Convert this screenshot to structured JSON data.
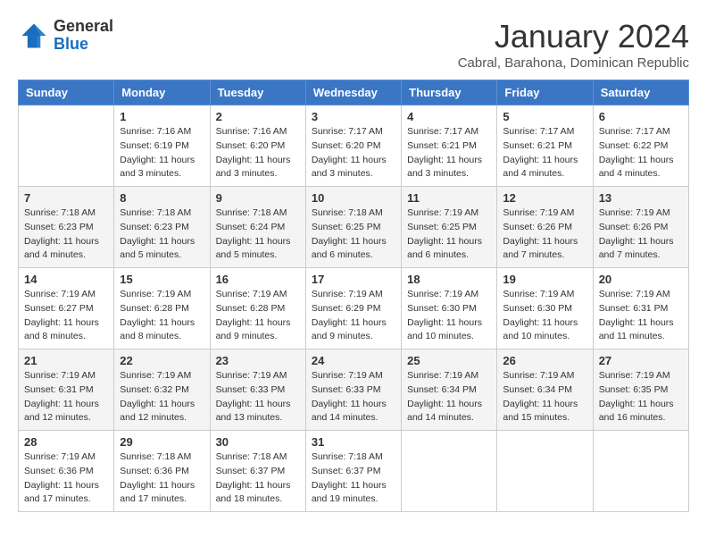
{
  "header": {
    "logo_general": "General",
    "logo_blue": "Blue",
    "main_title": "January 2024",
    "subtitle": "Cabral, Barahona, Dominican Republic"
  },
  "days_of_week": [
    "Sunday",
    "Monday",
    "Tuesday",
    "Wednesday",
    "Thursday",
    "Friday",
    "Saturday"
  ],
  "weeks": [
    [
      {
        "day": "",
        "info": ""
      },
      {
        "day": "1",
        "info": "Sunrise: 7:16 AM\nSunset: 6:19 PM\nDaylight: 11 hours\nand 3 minutes."
      },
      {
        "day": "2",
        "info": "Sunrise: 7:16 AM\nSunset: 6:20 PM\nDaylight: 11 hours\nand 3 minutes."
      },
      {
        "day": "3",
        "info": "Sunrise: 7:17 AM\nSunset: 6:20 PM\nDaylight: 11 hours\nand 3 minutes."
      },
      {
        "day": "4",
        "info": "Sunrise: 7:17 AM\nSunset: 6:21 PM\nDaylight: 11 hours\nand 3 minutes."
      },
      {
        "day": "5",
        "info": "Sunrise: 7:17 AM\nSunset: 6:21 PM\nDaylight: 11 hours\nand 4 minutes."
      },
      {
        "day": "6",
        "info": "Sunrise: 7:17 AM\nSunset: 6:22 PM\nDaylight: 11 hours\nand 4 minutes."
      }
    ],
    [
      {
        "day": "7",
        "info": "Sunrise: 7:18 AM\nSunset: 6:23 PM\nDaylight: 11 hours\nand 4 minutes."
      },
      {
        "day": "8",
        "info": "Sunrise: 7:18 AM\nSunset: 6:23 PM\nDaylight: 11 hours\nand 5 minutes."
      },
      {
        "day": "9",
        "info": "Sunrise: 7:18 AM\nSunset: 6:24 PM\nDaylight: 11 hours\nand 5 minutes."
      },
      {
        "day": "10",
        "info": "Sunrise: 7:18 AM\nSunset: 6:25 PM\nDaylight: 11 hours\nand 6 minutes."
      },
      {
        "day": "11",
        "info": "Sunrise: 7:19 AM\nSunset: 6:25 PM\nDaylight: 11 hours\nand 6 minutes."
      },
      {
        "day": "12",
        "info": "Sunrise: 7:19 AM\nSunset: 6:26 PM\nDaylight: 11 hours\nand 7 minutes."
      },
      {
        "day": "13",
        "info": "Sunrise: 7:19 AM\nSunset: 6:26 PM\nDaylight: 11 hours\nand 7 minutes."
      }
    ],
    [
      {
        "day": "14",
        "info": "Sunrise: 7:19 AM\nSunset: 6:27 PM\nDaylight: 11 hours\nand 8 minutes."
      },
      {
        "day": "15",
        "info": "Sunrise: 7:19 AM\nSunset: 6:28 PM\nDaylight: 11 hours\nand 8 minutes."
      },
      {
        "day": "16",
        "info": "Sunrise: 7:19 AM\nSunset: 6:28 PM\nDaylight: 11 hours\nand 9 minutes."
      },
      {
        "day": "17",
        "info": "Sunrise: 7:19 AM\nSunset: 6:29 PM\nDaylight: 11 hours\nand 9 minutes."
      },
      {
        "day": "18",
        "info": "Sunrise: 7:19 AM\nSunset: 6:30 PM\nDaylight: 11 hours\nand 10 minutes."
      },
      {
        "day": "19",
        "info": "Sunrise: 7:19 AM\nSunset: 6:30 PM\nDaylight: 11 hours\nand 10 minutes."
      },
      {
        "day": "20",
        "info": "Sunrise: 7:19 AM\nSunset: 6:31 PM\nDaylight: 11 hours\nand 11 minutes."
      }
    ],
    [
      {
        "day": "21",
        "info": "Sunrise: 7:19 AM\nSunset: 6:31 PM\nDaylight: 11 hours\nand 12 minutes."
      },
      {
        "day": "22",
        "info": "Sunrise: 7:19 AM\nSunset: 6:32 PM\nDaylight: 11 hours\nand 12 minutes."
      },
      {
        "day": "23",
        "info": "Sunrise: 7:19 AM\nSunset: 6:33 PM\nDaylight: 11 hours\nand 13 minutes."
      },
      {
        "day": "24",
        "info": "Sunrise: 7:19 AM\nSunset: 6:33 PM\nDaylight: 11 hours\nand 14 minutes."
      },
      {
        "day": "25",
        "info": "Sunrise: 7:19 AM\nSunset: 6:34 PM\nDaylight: 11 hours\nand 14 minutes."
      },
      {
        "day": "26",
        "info": "Sunrise: 7:19 AM\nSunset: 6:34 PM\nDaylight: 11 hours\nand 15 minutes."
      },
      {
        "day": "27",
        "info": "Sunrise: 7:19 AM\nSunset: 6:35 PM\nDaylight: 11 hours\nand 16 minutes."
      }
    ],
    [
      {
        "day": "28",
        "info": "Sunrise: 7:19 AM\nSunset: 6:36 PM\nDaylight: 11 hours\nand 17 minutes."
      },
      {
        "day": "29",
        "info": "Sunrise: 7:18 AM\nSunset: 6:36 PM\nDaylight: 11 hours\nand 17 minutes."
      },
      {
        "day": "30",
        "info": "Sunrise: 7:18 AM\nSunset: 6:37 PM\nDaylight: 11 hours\nand 18 minutes."
      },
      {
        "day": "31",
        "info": "Sunrise: 7:18 AM\nSunset: 6:37 PM\nDaylight: 11 hours\nand 19 minutes."
      },
      {
        "day": "",
        "info": ""
      },
      {
        "day": "",
        "info": ""
      },
      {
        "day": "",
        "info": ""
      }
    ]
  ]
}
